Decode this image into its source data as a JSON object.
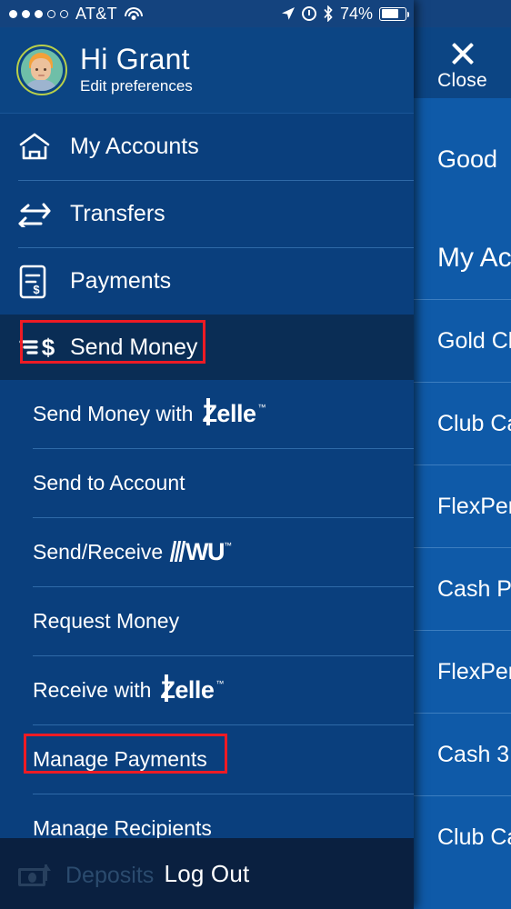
{
  "status_bar": {
    "carrier": "AT&T",
    "signal_dots_filled": 3,
    "signal_dots_total": 5,
    "wifi_icon": "wifi-icon",
    "location_icon": "location-arrow-icon",
    "alarm_icon": "alarm-clock-icon",
    "bluetooth_icon": "bluetooth-icon",
    "battery_percent": "74%",
    "battery_level": 74
  },
  "drawer": {
    "profile": {
      "greeting": "Hi Grant",
      "subtitle": "Edit preferences",
      "avatar_icon": "user-avatar"
    },
    "primary_items": [
      {
        "label": "My Accounts",
        "icon": "home-icon"
      },
      {
        "label": "Transfers",
        "icon": "transfer-arrows-icon"
      },
      {
        "label": "Payments",
        "icon": "invoice-dollar-icon"
      }
    ],
    "active_item": {
      "label": "Send Money",
      "icon": "send-money-dollar-icon"
    },
    "sub_items": [
      {
        "label": "Send Money with",
        "brand": "Zelle",
        "brand_tm": "™"
      },
      {
        "label": "Send to Account",
        "brand": "",
        "brand_tm": ""
      },
      {
        "label": "Send/Receive",
        "brand": "WU",
        "brand_tm": "™"
      },
      {
        "label": "Request Money",
        "brand": "",
        "brand_tm": ""
      },
      {
        "label": "Receive with",
        "brand": "Zelle",
        "brand_tm": "™"
      },
      {
        "label": "Manage Payments",
        "brand": "",
        "brand_tm": ""
      },
      {
        "label": "Manage Recipients",
        "brand": "",
        "brand_tm": ""
      }
    ],
    "dimmed_item": {
      "label": "Deposits",
      "icon": "check-deposit-icon"
    },
    "logout_label": "Log Out"
  },
  "annotations": {
    "highlight_color": "#ee1b24",
    "boxes": [
      {
        "target": "Send Money"
      },
      {
        "target": "Manage Payments"
      }
    ]
  },
  "right_panel": {
    "close_label": "Close",
    "close_icon": "close-x-icon",
    "greeting": "Good",
    "section_heading": "My Ac",
    "accounts": [
      {
        "label": "Gold Cl"
      },
      {
        "label": "Club Ca"
      },
      {
        "label": "FlexPer"
      },
      {
        "label": "Cash P"
      },
      {
        "label": "FlexPer"
      },
      {
        "label": "Cash 3"
      },
      {
        "label": "Club Ca"
      }
    ]
  },
  "colors": {
    "drawer_bg": "#0a3f7d",
    "profile_bg": "#0c4584",
    "active_row_bg": "#0a2d55",
    "panel_bg": "#0f5aa8",
    "divider": "#2f6aa8",
    "accent_red": "#ee1b24"
  }
}
